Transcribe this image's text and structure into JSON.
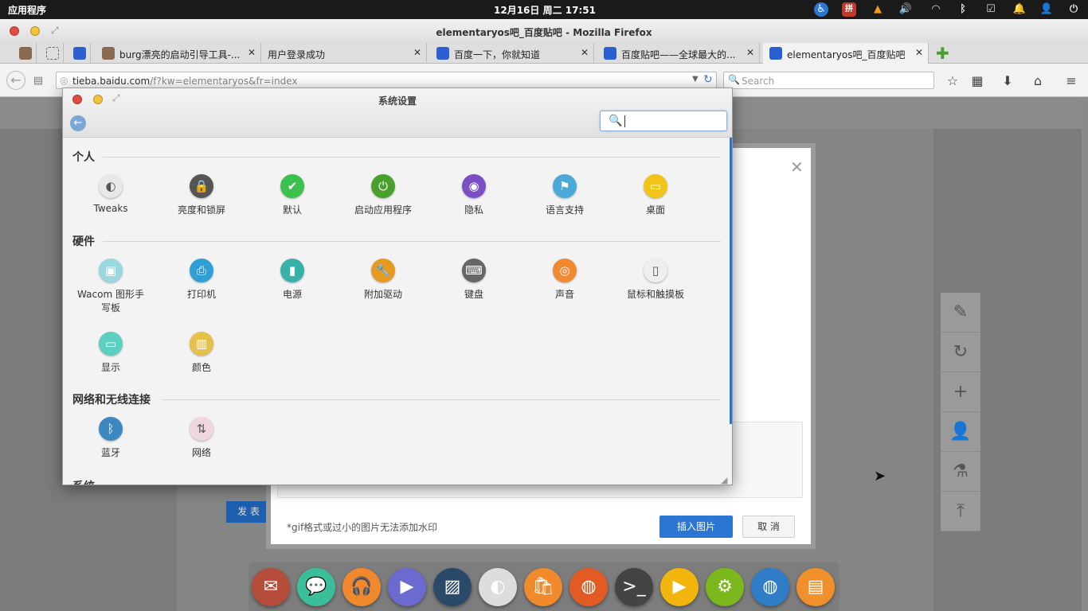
{
  "panel": {
    "apps_label": "应用程序",
    "clock": "12月16日 周二 17:51"
  },
  "firefox": {
    "window_title": "elementaryos吧_百度贴吧 - Mozilla Firefox",
    "tabs": [
      {
        "label": "burg漂亮的启动引导工具-..."
      },
      {
        "label": "用户登录成功"
      },
      {
        "label": "百度一下，你就知道"
      },
      {
        "label": "百度贴吧——全球最大的..."
      },
      {
        "label": "elementaryos吧_百度贴吧"
      }
    ],
    "url_host": "tieba.baidu.com",
    "url_path": "/f?kw=elementaryos&fr=index",
    "search_placeholder": "Search"
  },
  "page": {
    "note": "*gif格式或过小的图片无法添加水印",
    "insert_button": "插入图片",
    "cancel_button": "取 消",
    "publish_button": "发 表"
  },
  "settings": {
    "title": "系统设置",
    "categories": [
      {
        "name": "个人",
        "items": [
          {
            "label": "Tweaks",
            "icon": "toggle-icon",
            "color": "#e8e8e8"
          },
          {
            "label": "亮度和锁屏",
            "icon": "lock-screen-icon",
            "color": "#555555"
          },
          {
            "label": "默认",
            "icon": "check-icon",
            "color": "#3cc04e"
          },
          {
            "label": "启动应用程序",
            "icon": "power-icon",
            "color": "#4aa02c"
          },
          {
            "label": "隐私",
            "icon": "eye-icon",
            "color": "#7c4fc4"
          },
          {
            "label": "语言支持",
            "icon": "flag-icon",
            "color": "#4aa9d6"
          },
          {
            "label": "桌面",
            "icon": "desktop-icon",
            "color": "#f2c417"
          }
        ]
      },
      {
        "name": "硬件",
        "items": [
          {
            "label": "Wacom 图形手写板",
            "icon": "tablet-icon",
            "color": "#9ad8e0"
          },
          {
            "label": "打印机",
            "icon": "printer-icon",
            "color": "#2f9fd6"
          },
          {
            "label": "电源",
            "icon": "battery-icon",
            "color": "#38b2a8"
          },
          {
            "label": "附加驱动",
            "icon": "wrench-icon",
            "color": "#e69a22"
          },
          {
            "label": "键盘",
            "icon": "keyboard-icon",
            "color": "#666666"
          },
          {
            "label": "声音",
            "icon": "speaker-icon",
            "color": "#ef8a32"
          },
          {
            "label": "鼠标和触摸板",
            "icon": "mouse-icon",
            "color": "#eeeeee"
          },
          {
            "label": "显示",
            "icon": "display-icon",
            "color": "#5ccfc0"
          },
          {
            "label": "颜色",
            "icon": "color-icon",
            "color": "#e5c04a"
          }
        ]
      },
      {
        "name": "网络和无线连接",
        "items": [
          {
            "label": "蓝牙",
            "icon": "bluetooth-icon",
            "color": "#3d88c0"
          },
          {
            "label": "网络",
            "icon": "network-icon",
            "color": "#f0d6e0"
          }
        ]
      },
      {
        "name": "系统",
        "items": []
      }
    ]
  },
  "dock": [
    {
      "name": "mail",
      "color": "#b54d3a"
    },
    {
      "name": "chat",
      "color": "#3bbf9a"
    },
    {
      "name": "music",
      "color": "#f2882e"
    },
    {
      "name": "videos",
      "color": "#6a6ad0"
    },
    {
      "name": "photos",
      "color": "#2b4a6a"
    },
    {
      "name": "tweaks",
      "color": "#dddddd"
    },
    {
      "name": "software-center",
      "color": "#f08a2c"
    },
    {
      "name": "firefox",
      "color": "#e35b24"
    },
    {
      "name": "terminal",
      "color": "#444444"
    },
    {
      "name": "media-player",
      "color": "#f2b50e"
    },
    {
      "name": "ubuntu-tweak",
      "color": "#7ab81e"
    },
    {
      "name": "web-browser",
      "color": "#2f7cc8"
    },
    {
      "name": "files",
      "color": "#f0902c"
    }
  ]
}
